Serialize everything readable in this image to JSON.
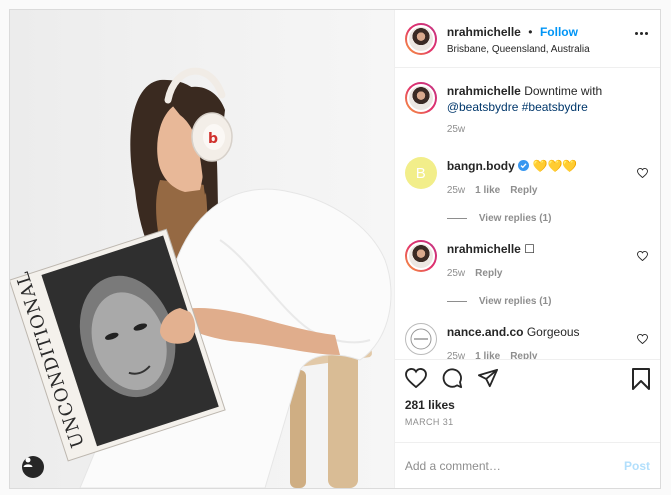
{
  "post": {
    "username": "nrahmichelle",
    "follow_label": "Follow",
    "location": "Brisbane, Queensland, Australia",
    "dot": "•"
  },
  "caption": {
    "username": "nrahmichelle",
    "text": "Downtime with",
    "mention": "@beatsbydre",
    "hashtag": "#beatsbydre",
    "time": "25w"
  },
  "comments": [
    {
      "username": "bangn.body",
      "text": "💛💛💛",
      "time": "25w",
      "likes": "1 like",
      "reply": "Reply",
      "view_replies": "View replies (1)",
      "avatar_letter": "B"
    },
    {
      "username": "nrahmichelle",
      "text": "☐",
      "time": "25w",
      "reply": "Reply",
      "view_replies": "View replies (1)"
    },
    {
      "username": "nance.and.co",
      "text": "Gorgeous",
      "time": "25w",
      "likes": "1 like",
      "reply": "Reply"
    }
  ],
  "stats": {
    "likes": "281 likes",
    "date": "MARCH 31"
  },
  "composer": {
    "placeholder": "Add a comment…",
    "post_label": "Post"
  },
  "photo": {
    "magazine_title": "UNCONDITIONAL"
  },
  "colors": {
    "accent": "#0095f6",
    "muted": "#8e8e8e",
    "text": "#262626",
    "post_disabled": "#b2dffc",
    "comment_avatar_yellow": "#f2ee8a"
  },
  "icons": [
    "more-options-icon",
    "heart-icon",
    "comment-icon",
    "share-icon",
    "bookmark-icon",
    "user-tag-icon",
    "verified-icon"
  ]
}
